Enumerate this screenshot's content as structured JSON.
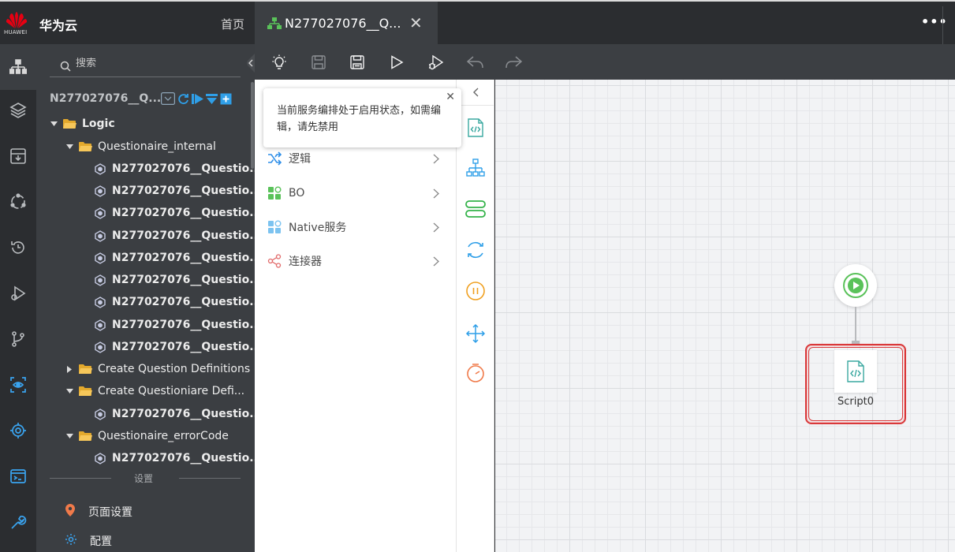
{
  "header": {
    "logo_text": "HUAWEI",
    "brand": "华为云",
    "home": "首页",
    "active_tab": "N277027076__Q...",
    "close_glyph": "✕",
    "more_glyph": "•••"
  },
  "rail": {
    "items": [
      "sitemap-icon",
      "layers-icon",
      "inbox-download-icon",
      "cycle-nodes-icon",
      "history-icon",
      "run-debug-icon",
      "branch-icon",
      "eye-scan-icon",
      "target-icon",
      "terminal-icon",
      "wrench-icon"
    ],
    "active_index": 0
  },
  "tree": {
    "search_placeholder": "搜索",
    "header": "N277027076__Q...",
    "header_icons": [
      "collapse-icon",
      "refresh-icon",
      "play-icon",
      "expand-all-icon",
      "add-icon"
    ],
    "rows": [
      {
        "label": "Logic",
        "type": "folder",
        "level": 0,
        "expanded": true
      },
      {
        "label": "Questionaire_internal",
        "type": "folder",
        "level": 1,
        "expanded": true
      },
      {
        "label": "N277027076__Questio...",
        "type": "flow",
        "level": 2
      },
      {
        "label": "N277027076__Questio...",
        "type": "flow",
        "level": 2
      },
      {
        "label": "N277027076__Questio...",
        "type": "flow",
        "level": 2
      },
      {
        "label": "N277027076__Questio...",
        "type": "flow",
        "level": 2
      },
      {
        "label": "N277027076__Questio...",
        "type": "flow",
        "level": 2
      },
      {
        "label": "N277027076__Questio...",
        "type": "flow",
        "level": 2
      },
      {
        "label": "N277027076__Questio...",
        "type": "flow",
        "level": 2
      },
      {
        "label": "N277027076__Questio...",
        "type": "flow",
        "level": 2
      },
      {
        "label": "N277027076__Questio...",
        "type": "flow",
        "level": 2
      },
      {
        "label": "Create Question Definitions",
        "type": "folder",
        "level": 1,
        "expanded": false
      },
      {
        "label": "Create Questioniare Defi...",
        "type": "folder",
        "level": 1,
        "expanded": true
      },
      {
        "label": "N277027076__Questio...",
        "type": "flow",
        "level": 2
      },
      {
        "label": "Questionaire_errorCode",
        "type": "folder",
        "level": 1,
        "expanded": true
      },
      {
        "label": "N277027076__Questio...",
        "type": "flow",
        "level": 2
      }
    ],
    "settings_divider": "设置",
    "settings": [
      {
        "label": "页面设置",
        "icon": "map-pin-icon"
      },
      {
        "label": "配置",
        "icon": "gear-icon"
      }
    ]
  },
  "toolbar": {
    "buttons": [
      "lightbulb-icon",
      "save-icon",
      "save-as-icon",
      "run-icon",
      "debug-icon",
      "undo-icon",
      "redo-icon"
    ]
  },
  "palette": {
    "tooltip": "当前服务编排处于启用状态，如需编辑，请先禁用",
    "tooltip_close": "✕",
    "items": [
      {
        "label": "逻辑",
        "icon": "shuffle-icon"
      },
      {
        "label": "BO",
        "icon": "bo-blocks-icon"
      },
      {
        "label": "Native服务",
        "icon": "native-blocks-icon"
      },
      {
        "label": "连接器",
        "icon": "share-nodes-icon"
      }
    ]
  },
  "strip": {
    "items": [
      "script-icon",
      "org-tree-icon",
      "database-icon",
      "loop-icon",
      "pause-icon",
      "split-arrows-icon",
      "timer-icon"
    ]
  },
  "canvas": {
    "start_icon": "play-circle-icon",
    "node_label": "Script0",
    "node_icon": "script-icon"
  },
  "colors": {
    "accent_green": "#5ac25a",
    "accent_blue": "#2f9fe8",
    "selection_red": "#d9383a",
    "logic_blue": "#2f8fe8",
    "connector_red": "#e26b6b"
  }
}
